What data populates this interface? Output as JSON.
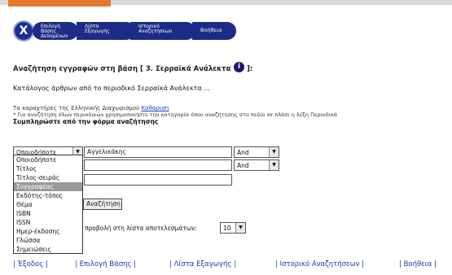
{
  "nav": {
    "close_label": "X",
    "pill1": [
      "Επιλογή",
      "Βάσης",
      "Δεδομένων"
    ],
    "pill2": [
      "Λίστα",
      "Εξαγωγής"
    ],
    "pill3": [
      "Ιστορικό",
      "Αναζητήσεων"
    ],
    "pill4": [
      "Βοήθεια"
    ]
  },
  "title": "Αναζήτηση εγγραφών στη βάση [ 3. Σερραϊκά Ανάλεκτα",
  "title_end": "]:",
  "subtitle": "Κατάλογος άρθρων από το περιοδικό Σερραϊκά Ανάλεκτα ...",
  "hint1_prefix": "Τα καραχτήρες της Ελληνικής Διαχωρισμού",
  "hint1_link": "Καθαριση",
  "hint2": "* Για αναζήτηση όλων περιοδικών χρησιμοποιήστε την κατηγορία όπου αναζήτησης στο πεδίο σε πλάσι η λέξη Περιοδικά",
  "hint3": "Συμπληρώστε από την φόρμα αναζήτησης",
  "row1": {
    "field": "Οποιοδήποτε",
    "value": "Αγγελικάκης",
    "op": "And"
  },
  "row2": {
    "op": "And"
  },
  "dropdown_options": [
    "Οποιοδήποτε",
    "Τίτλος",
    "Τίτλος-σειράς",
    "Συγγραφέας",
    "Εκδότης-τόπος",
    "Θέμα",
    "ISBN",
    "ISSN",
    "Ημερ-έκδοσης",
    "Γλώσσα",
    "Σημειώσεις"
  ],
  "dropdown_selected": "Συγγραφέας",
  "search_button": "Αναζήτηση",
  "perpage_label": "προβολή στη λίστα αποτελεσμάτων:",
  "perpage_value": "10",
  "footer": [
    "| Έξοδος |",
    "| Επιλογή Βάσης |",
    "| Λίστα Εξαγωγής |",
    "| Ιστορικό Αναζητήσεων |",
    "| Βοήθεια |"
  ]
}
